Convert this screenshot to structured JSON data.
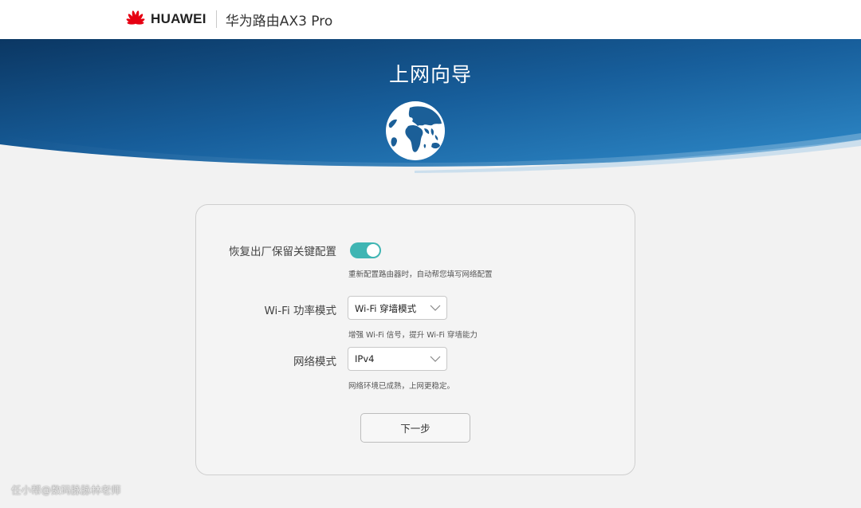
{
  "header": {
    "brand_name": "HUAWEI",
    "product_title": "华为路由AX3 Pro"
  },
  "banner": {
    "title": "上网向导",
    "icon": "globe-icon"
  },
  "form": {
    "restore": {
      "label": "恢复出厂保留关键配置",
      "enabled": true,
      "hint": "重新配置路由器时，自动帮您填写网络配置"
    },
    "wifi_power": {
      "label": "Wi-Fi 功率模式",
      "value": "Wi-Fi 穿墙模式",
      "hint": "增强 Wi-Fi 信号，提升 Wi-Fi 穿墙能力"
    },
    "network_mode": {
      "label": "网络模式",
      "value": "IPv4",
      "hint": "网络环境已成熟，上网更稳定。"
    },
    "next_label": "下一步"
  },
  "watermark": "任小帮@数码脉脉林老师",
  "colors": {
    "banner_dark": "#0d3d6e",
    "banner_light": "#2a86c6",
    "toggle_on": "#3fb5b3",
    "logo_red": "#e60012"
  }
}
